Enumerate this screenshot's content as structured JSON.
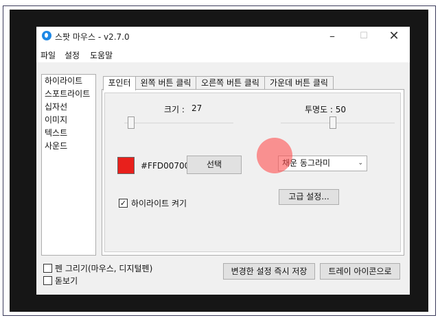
{
  "window": {
    "title": "스팟 마우스 - v2.7.0",
    "minimize_glyph": "–",
    "maximize_glyph": "☐",
    "close_glyph": "✕"
  },
  "menu": [
    "파일",
    "설정",
    "도움말"
  ],
  "sidebar": {
    "items": [
      "하이라이트",
      "스포트라이트",
      "십자선",
      "이미지",
      "텍스트",
      "사운드"
    ]
  },
  "tabs": [
    "포인터",
    "왼쪽 버튼 클릭",
    "오른쪽 버튼 클릭",
    "가운데 버튼 클릭"
  ],
  "pointer": {
    "size_label": "크기 :",
    "size_value": "27",
    "opacity_label": "투명도 : 50",
    "color_hex": "#FFD00700",
    "color_swatch": "#e8201c",
    "select_label": "선택",
    "shape_value": "채운 동그라미",
    "highlight_label": "하이라이트 켜기",
    "highlight_checked": true,
    "advanced_label": "고급 설정...",
    "cursor_highlight_color": "#ff5050"
  },
  "bottom": {
    "pen_label": "펜 그리기(마우스, 디지털펜)",
    "pen_checked": false,
    "magnifier_label": "돋보기",
    "magnifier_checked": false,
    "save_label": "변경한 설정 즉시 저장",
    "tray_label": "트레이 아이콘으로"
  }
}
